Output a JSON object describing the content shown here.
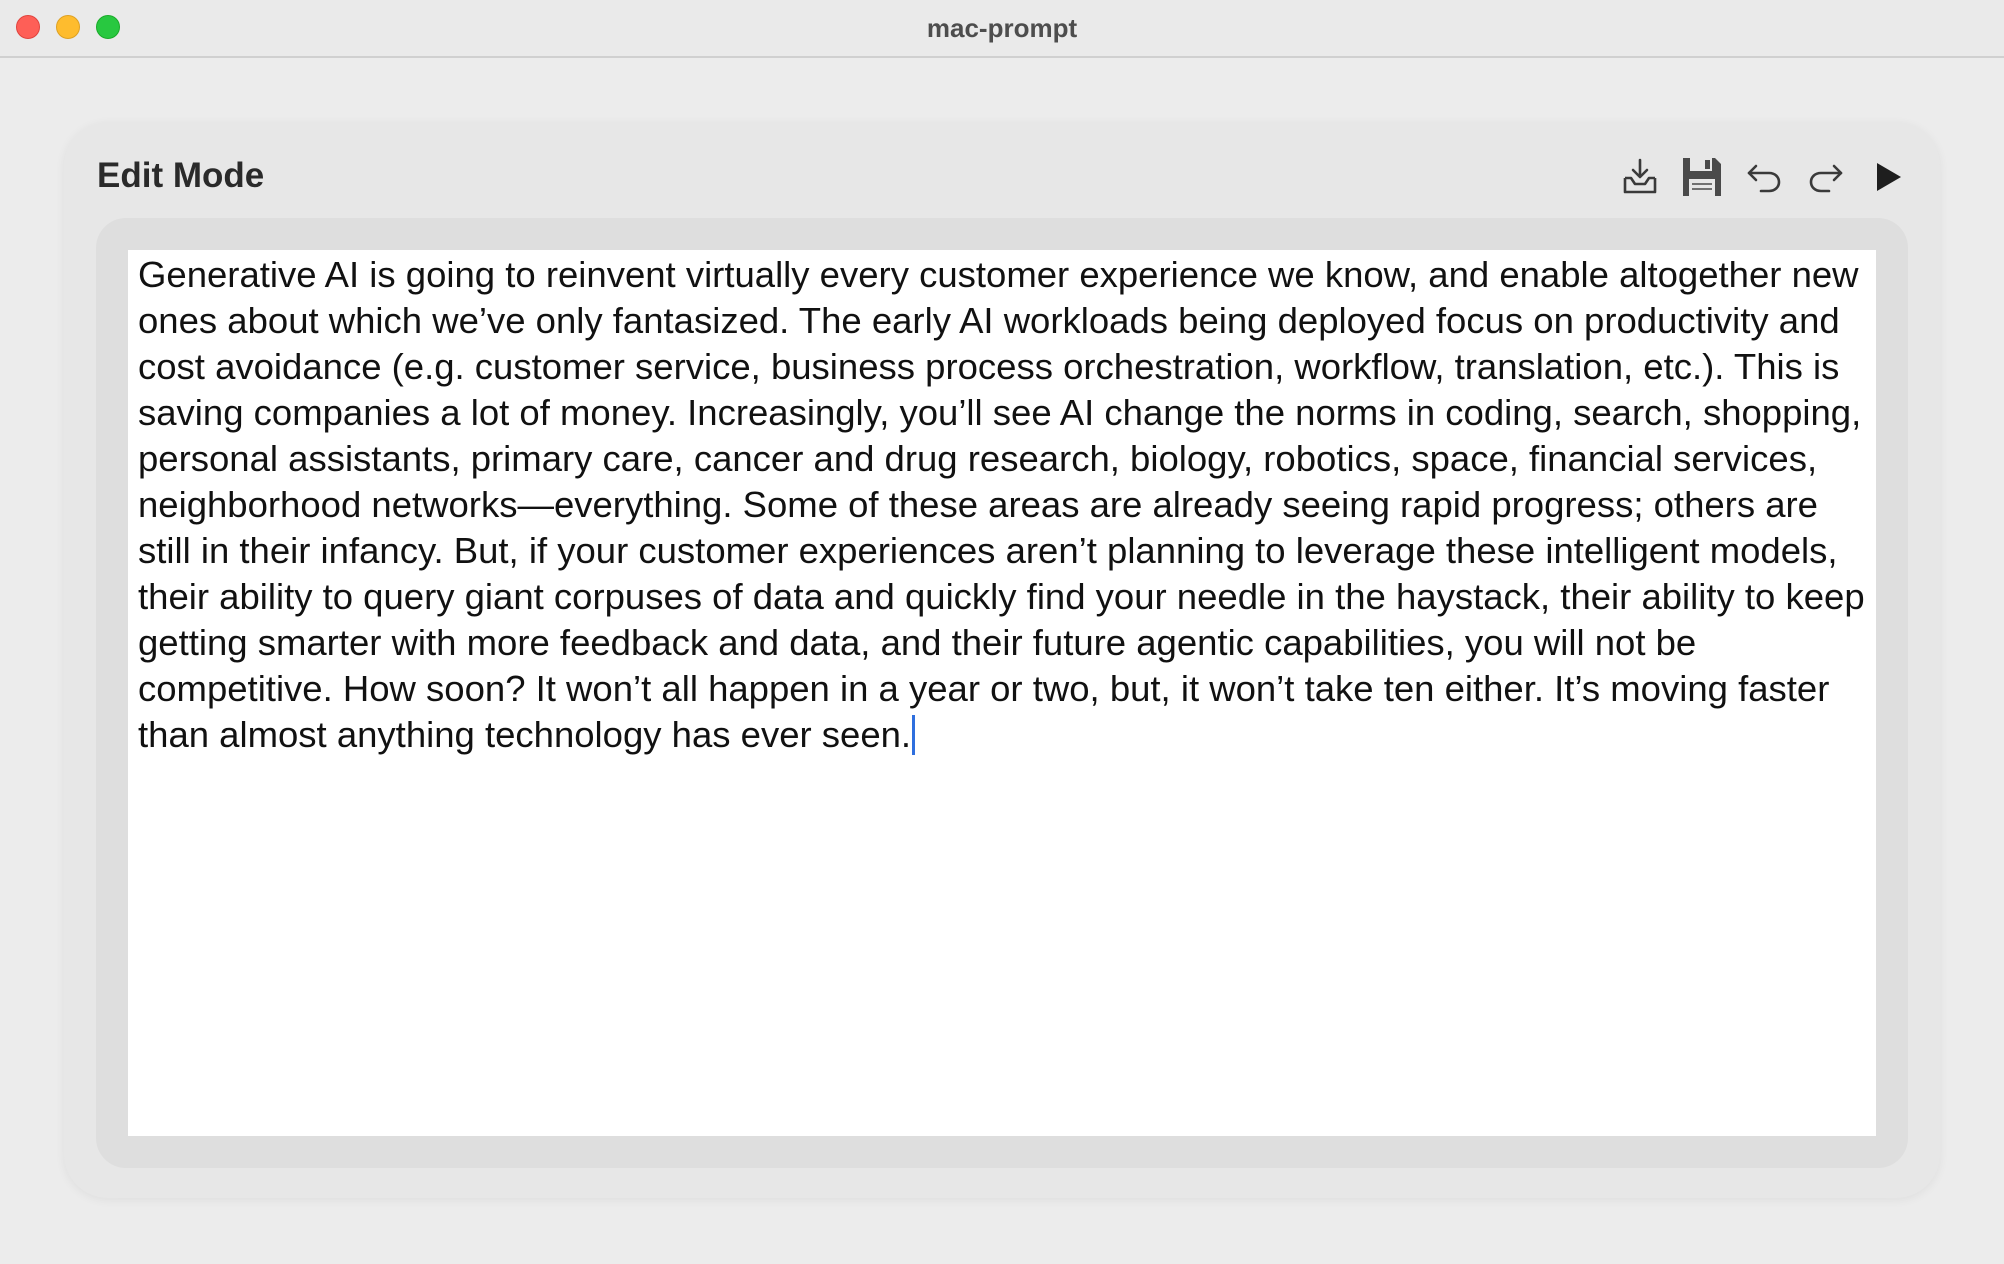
{
  "window": {
    "title": "mac-prompt"
  },
  "traffic_lights": {
    "close_color": "#fe5f57",
    "minimize_color": "#febc2e",
    "zoom_color": "#28c840"
  },
  "panel": {
    "mode_label": "Edit Mode",
    "toolbar": [
      {
        "name": "import-icon",
        "label": "Import"
      },
      {
        "name": "save-icon",
        "label": "Save"
      },
      {
        "name": "undo-icon",
        "label": "Undo"
      },
      {
        "name": "redo-icon",
        "label": "Redo"
      },
      {
        "name": "play-icon",
        "label": "Run"
      }
    ]
  },
  "editor": {
    "text": "Generative AI is going to reinvent virtually every customer experience we know, and enable altogether new ones about which we’ve only fantasized. The early AI workloads being deployed focus on productivity and cost avoidance (e.g. customer service, business process orchestration, workflow, translation, etc.). This is saving companies a lot of money. Increasingly, you’ll see AI change the norms in coding, search, shopping, personal assistants, primary care, cancer and drug research, biology, robotics, space, financial services, neighborhood networks—everything. Some of these areas are already seeing rapid progress; others are still in their infancy. But, if your customer experiences aren’t planning to leverage these intelligent models, their ability to query giant corpuses of data and quickly find your needle in the haystack, their ability to keep getting smarter with more feedback and data, and their future agentic capabilities, you will not be competitive. How soon? It won’t all happen in a year or two, but, it won’t take ten either. It’s moving faster than almost anything technology has ever seen.",
    "caret_color": "#2f6fde"
  }
}
